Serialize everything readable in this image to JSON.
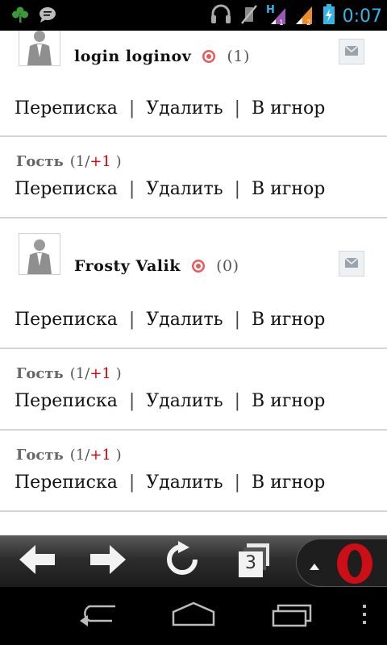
{
  "status_bar": {
    "time": "0:07",
    "icons": [
      "clover-icon",
      "chat-bubble-icon",
      "headset-icon",
      "vibrate-off-icon",
      "h-signal-1-icon",
      "signal-2-icon",
      "battery-charging-icon"
    ]
  },
  "entries": [
    {
      "kind": "user",
      "name": "login  loginov",
      "count": "(1)"
    },
    {
      "kind": "guest",
      "name": "Гость",
      "count_prefix": "(1/",
      "count_plus": "+1",
      "count_suffix": ")"
    },
    {
      "kind": "user",
      "name": "Frosty  Valik",
      "count": "(0)"
    },
    {
      "kind": "guest",
      "name": "Гость",
      "count_prefix": "(1/",
      "count_plus": "+1",
      "count_suffix": ")"
    },
    {
      "kind": "guest",
      "name": "Гость",
      "count_prefix": "(1/",
      "count_plus": "+1",
      "count_suffix": ")"
    }
  ],
  "actions": {
    "correspondence": "Переписка",
    "delete": "Удалить",
    "ignore": "В игнор",
    "separator": "|"
  },
  "toolbar": {
    "tabs_count": "3"
  },
  "colors": {
    "clock": "#33b5e5",
    "plus_one": "#dd0000",
    "opera_red": "#cc0f16"
  }
}
